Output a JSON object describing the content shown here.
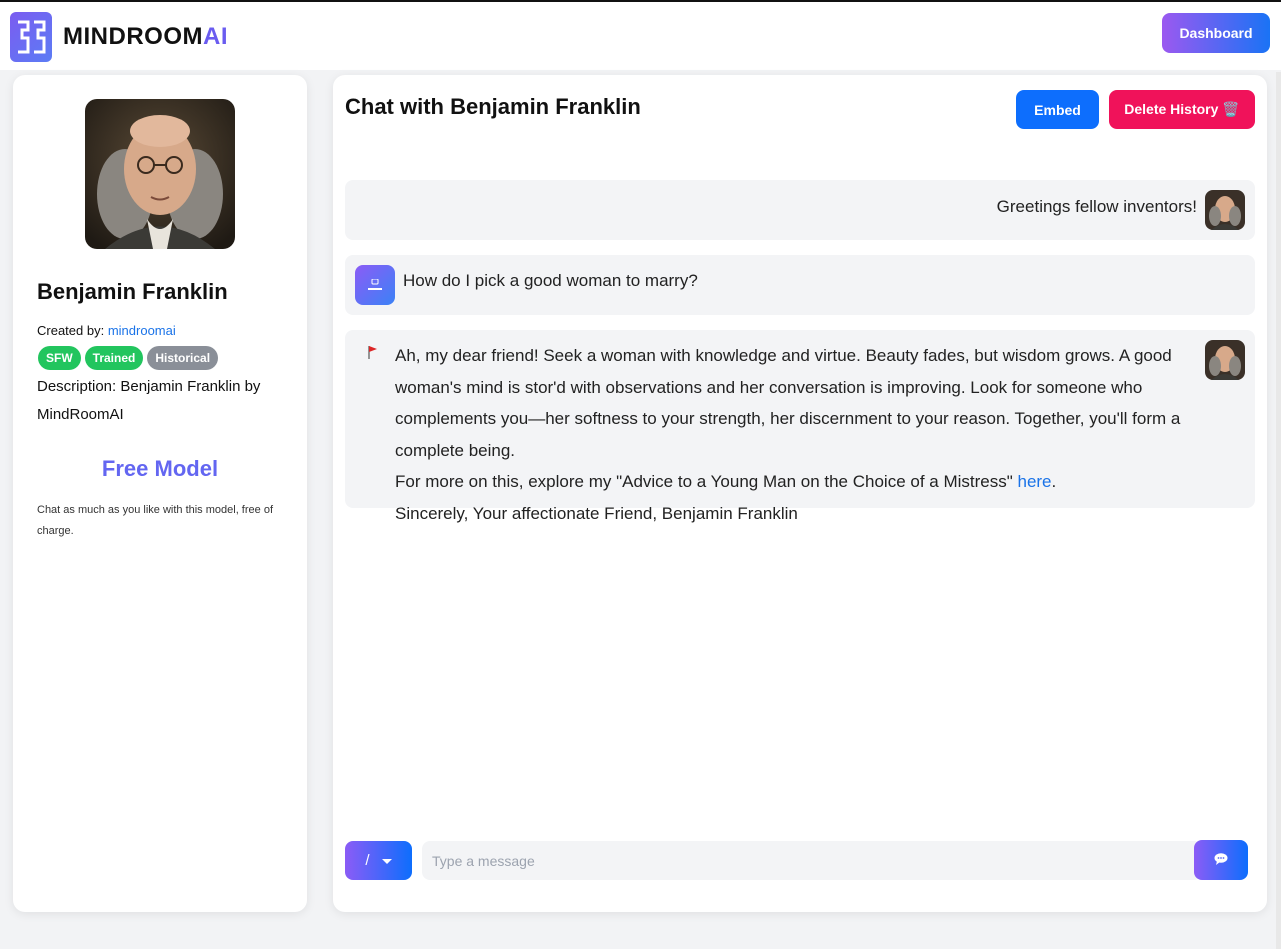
{
  "brand": {
    "name_main": "MINDROOM",
    "name_accent": "AI"
  },
  "header": {
    "dashboard_label": "Dashboard"
  },
  "character": {
    "name": "Benjamin Franklin",
    "created_by_label": "Created by:",
    "created_by_user": "mindroomai",
    "tags": [
      "SFW",
      "Trained",
      "Historical"
    ],
    "description": "Description: Benjamin Franklin by MindRoomAI",
    "plan_title": "Free Model",
    "plan_desc": "Chat as much as you like with this model, free of charge."
  },
  "chat": {
    "title": "Chat with Benjamin Franklin",
    "embed_label": "Embed",
    "delete_label": "Delete History 🗑️",
    "messages": [
      {
        "text": "Greetings fellow inventors!"
      },
      {
        "text": "How do I pick a good woman to marry?"
      },
      {
        "line1": "Ah, my dear friend! Seek a woman with knowledge and virtue. Beauty fades, but wisdom grows. A good woman's mind is stor'd with observations and her conversation is improving. Look for someone who complements you—her softness to your strength, her discernment to your reason. Together, you'll form a complete being.",
        "line2_pre": "For more on this, explore my \"Advice to a Young Man on the Choice of a Mistress\" ",
        "link_text": "here",
        "line2_post": ".",
        "line3": "Sincerely, Your affectionate Friend, Benjamin Franklin"
      }
    ],
    "command_label": "/",
    "input_placeholder": "Type a message"
  },
  "icons": {
    "send": "chat-bubble-icon",
    "flag": "flag-icon",
    "user": "user-icon"
  },
  "colors": {
    "accent_purple": "#8b5cf6",
    "accent_blue": "#0d6efd",
    "danger": "#f0125a",
    "tag_green": "#22c55e",
    "tag_gray": "#8a8f98"
  }
}
